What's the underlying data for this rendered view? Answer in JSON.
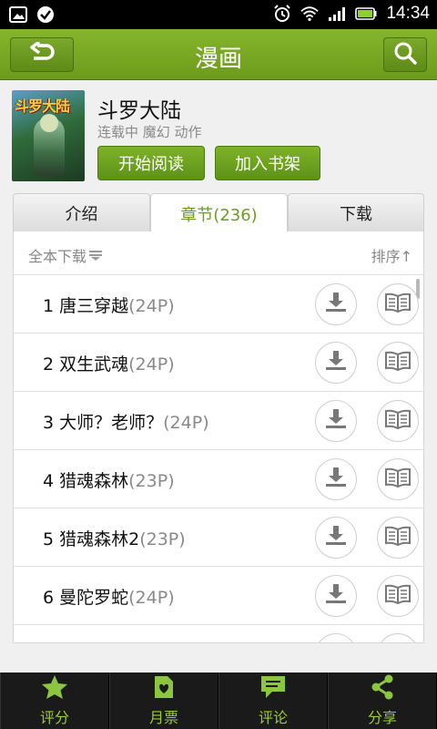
{
  "status_bar": {
    "time": "14:34",
    "icons": [
      "picture-icon",
      "check-circle-icon",
      "alarm-icon",
      "wifi-icon",
      "signal-icon",
      "battery-icon"
    ]
  },
  "header": {
    "title": "漫画",
    "back_icon": "back-arrow-icon",
    "search_icon": "search-icon"
  },
  "book": {
    "cover_text": "斗罗大陆",
    "title": "斗罗大陆",
    "meta": "连载中 魔幻 动作",
    "read_button": "开始阅读",
    "shelf_button": "加入书架"
  },
  "tabs": [
    {
      "label": "介绍",
      "active": false
    },
    {
      "label": "章节(236)",
      "active": true
    },
    {
      "label": "下载",
      "active": false
    }
  ],
  "toolbar": {
    "download_all": "全本下载",
    "sort": "排序↑"
  },
  "chapters": [
    {
      "title": "1 唐三穿越",
      "pages": "(24P)"
    },
    {
      "title": "2 双生武魂",
      "pages": "(24P)"
    },
    {
      "title": "3 大师？老师？",
      "pages": "(24P)"
    },
    {
      "title": "4 猎魂森林",
      "pages": "(23P)"
    },
    {
      "title": "5 猎魂森林2",
      "pages": "(23P)"
    },
    {
      "title": "6 曼陀罗蛇",
      "pages": "(24P)"
    },
    {
      "title": "",
      "pages": ""
    }
  ],
  "bottom_nav": [
    {
      "label": "评分",
      "icon": "star-icon"
    },
    {
      "label": "月票",
      "icon": "ticket-icon"
    },
    {
      "label": "评论",
      "icon": "comment-icon"
    },
    {
      "label": "分享",
      "icon": "share-icon"
    }
  ],
  "colors": {
    "header_green": "#7aa926",
    "accent_green": "#6a9e1f",
    "bottom_bar": "#1a1a1a",
    "bottom_label": "#9ccc2e"
  }
}
